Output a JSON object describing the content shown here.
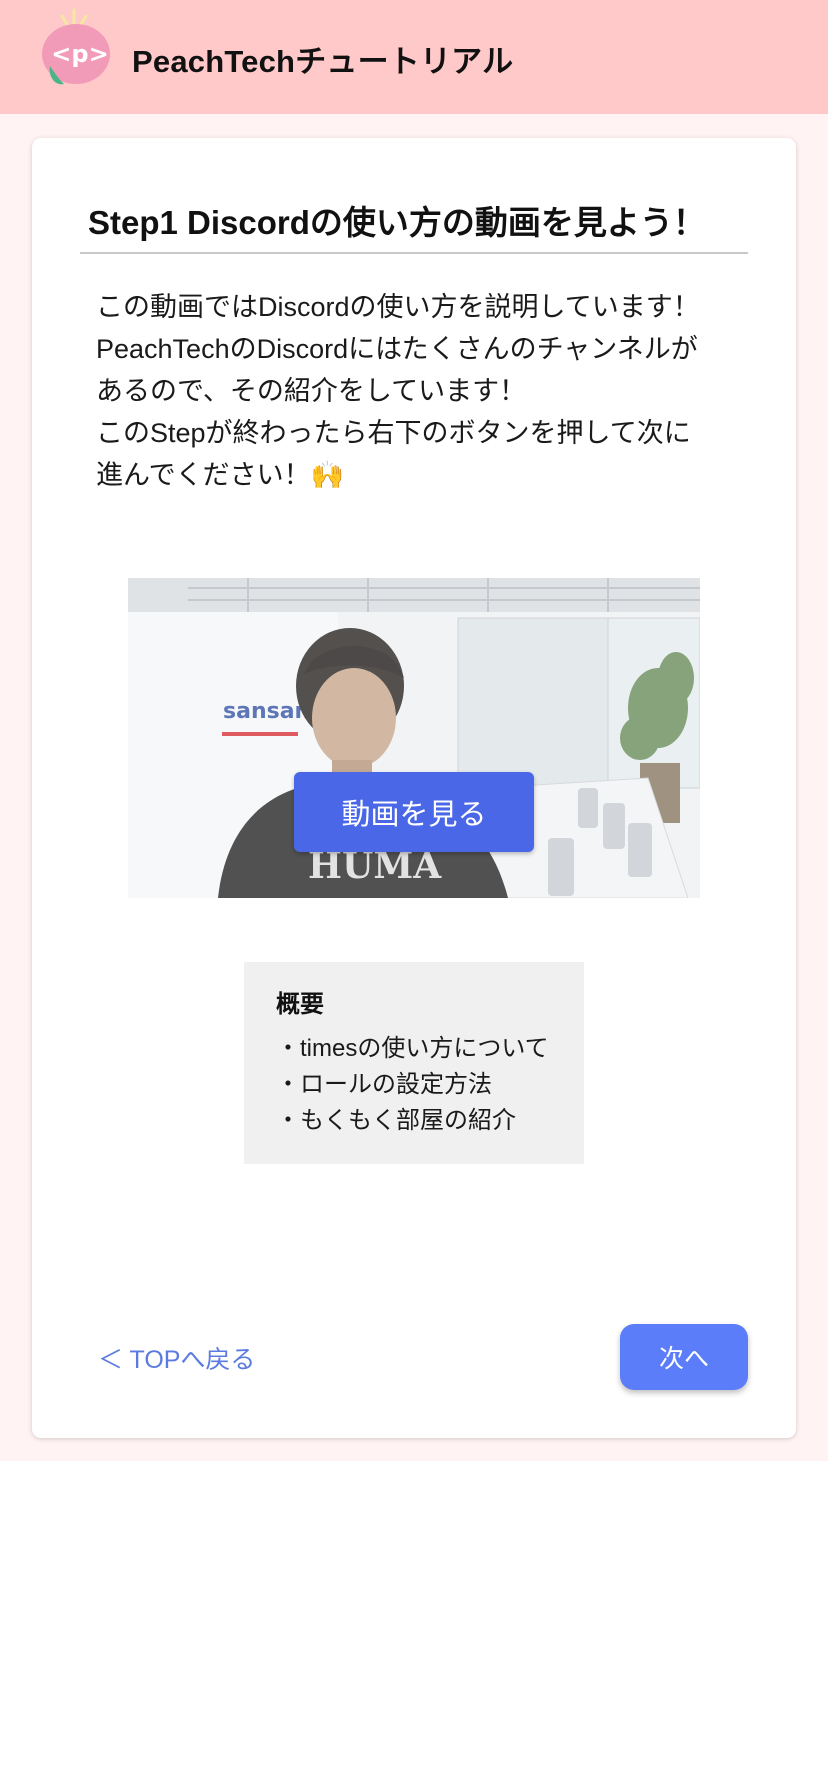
{
  "header": {
    "app_title": "PeachTechチュートリアル",
    "logo_text": "<p>",
    "logo_color": "#f29bb8",
    "background": "#ffc9ca"
  },
  "step": {
    "title": "Step1  Discordの使い方の動画を見よう！",
    "intro_lines": [
      "この動画ではDiscordの使い方を説明しています！",
      "PeachTechのDiscordにはたくさんのチャンネルが",
      "あるので、その紹介をしています！",
      "このStepが終わったら右下のボタンを押して次に",
      "進んでください！🙌"
    ]
  },
  "video": {
    "watermark_text": "sansan",
    "play_label": "動画を見る",
    "button_color": "#4a67e8"
  },
  "summary": {
    "title": "概要",
    "items": [
      "・timesの使い方について",
      "・ロールの設定方法",
      "・もくもく部屋の紹介"
    ]
  },
  "nav": {
    "back_label": "＜ TOPへ戻る",
    "next_label": "次へ",
    "accent": "#5b7df9"
  }
}
